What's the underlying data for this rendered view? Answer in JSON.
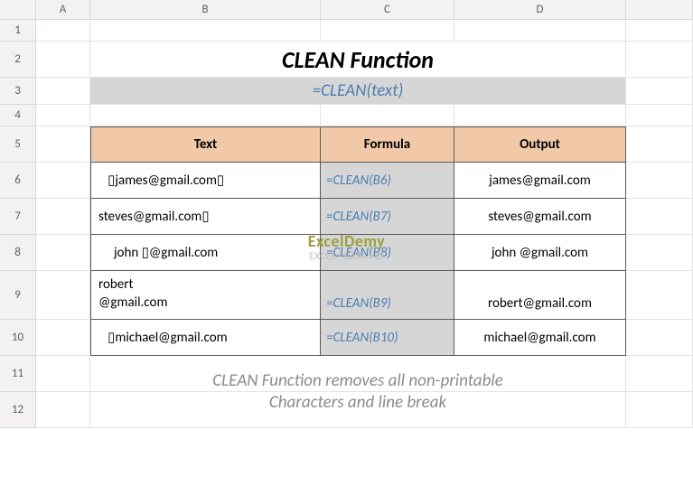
{
  "columns": [
    "",
    "A",
    "B",
    "C",
    "D",
    ""
  ],
  "rows": [
    "1",
    "2",
    "3",
    "4",
    "5",
    "6",
    "7",
    "8",
    "9",
    "10",
    "11",
    "12"
  ],
  "title": "CLEAN Function",
  "syntax": "=CLEAN(text)",
  "headers": {
    "text": "Text",
    "formula": "Formula",
    "output": "Output"
  },
  "data": [
    {
      "text": "   ▯james@gmail.com▯",
      "formula": "=CLEAN(B6)",
      "output": "james@gmail.com"
    },
    {
      "text": "steves@gmail.com▯",
      "formula": "=CLEAN(B7)",
      "output": "steves@gmail.com"
    },
    {
      "text": "     john ▯@gmail.com",
      "formula": "=CLEAN(B8)",
      "output": "john @gmail.com"
    },
    {
      "text": "robert\n@gmail.com",
      "formula": "=CLEAN(B9)",
      "output": "robert@gmail.com"
    },
    {
      "text": "   ▯michael@gmail.com",
      "formula": "=CLEAN(B10)",
      "output": "michael@gmail.com"
    }
  ],
  "footer": {
    "line1": "CLEAN Function removes all non-printable",
    "line2": "Characters and line break"
  },
  "watermark": {
    "brand": "ExcelDemy",
    "tag": "EXCEL · DATA · BI"
  }
}
